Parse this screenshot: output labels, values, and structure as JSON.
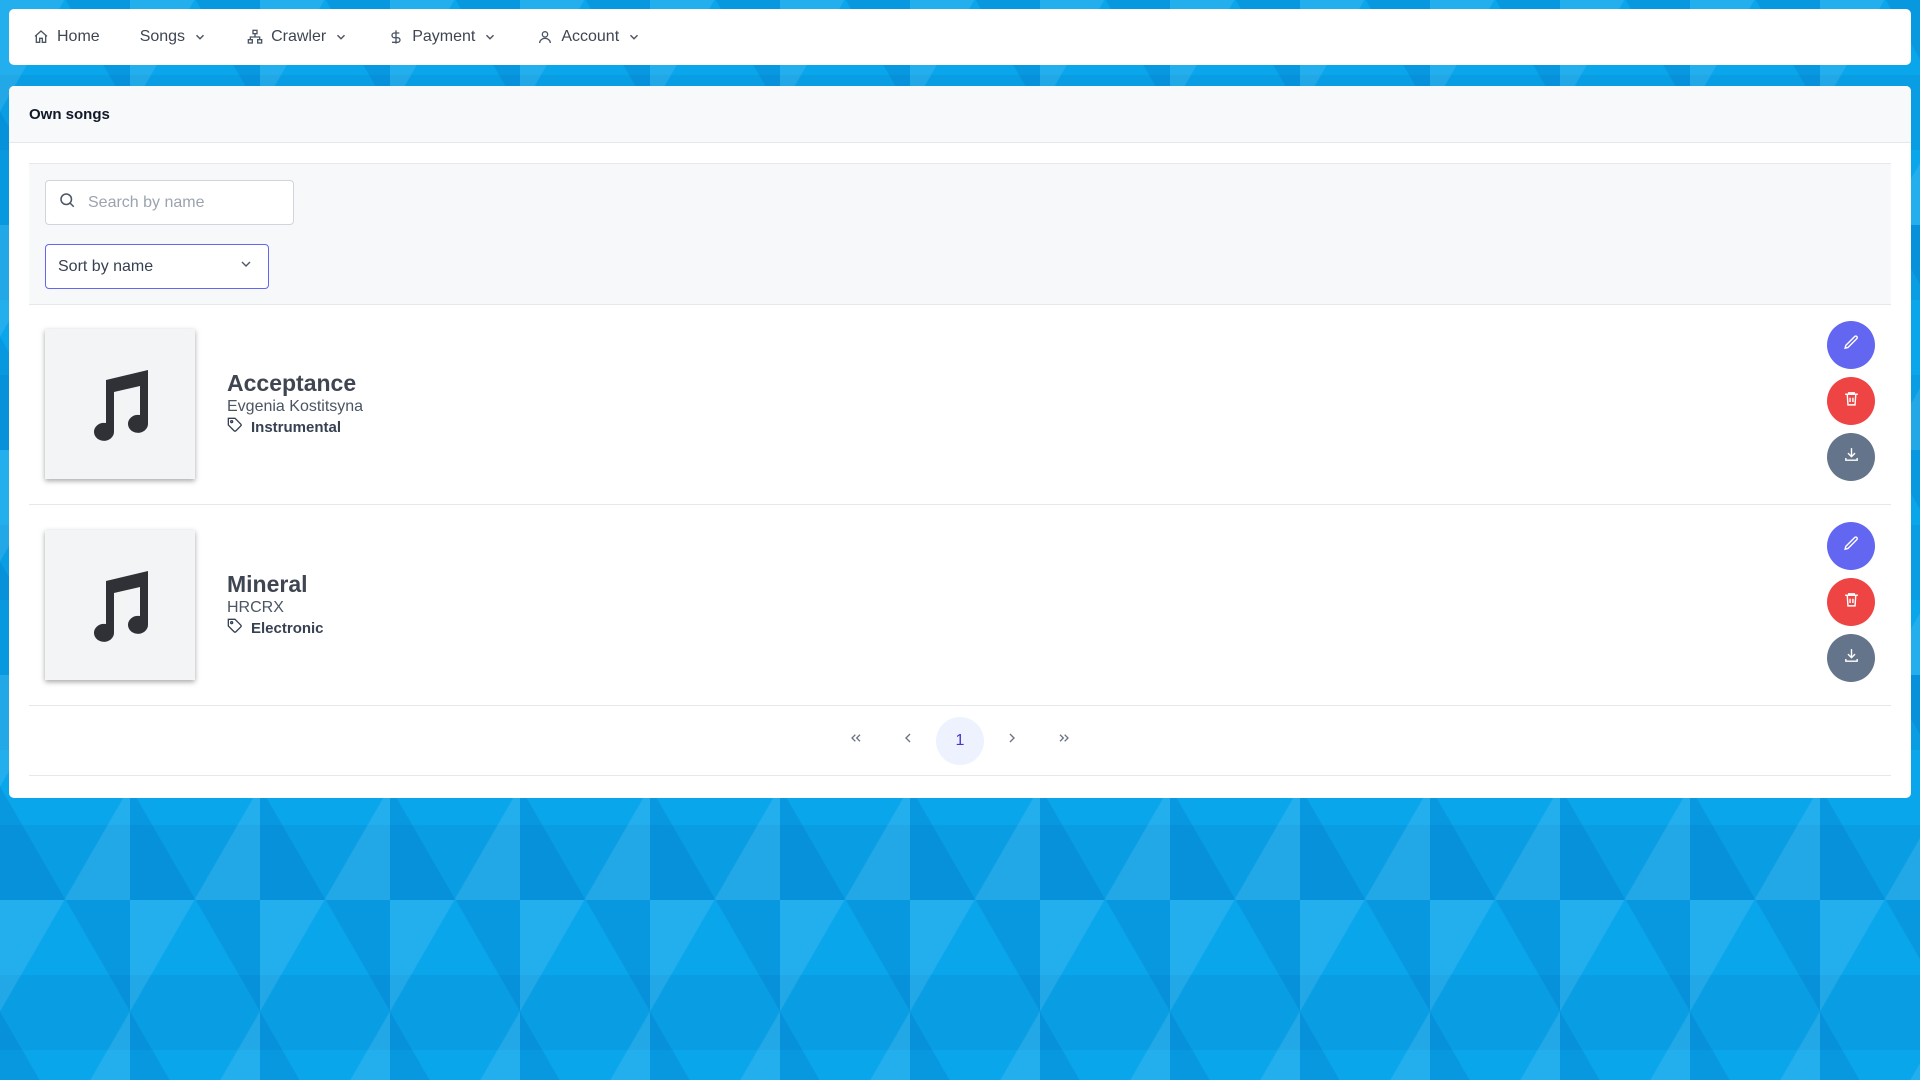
{
  "nav": {
    "items": [
      {
        "label": "Home",
        "icon": "home-icon"
      },
      {
        "label": "Songs",
        "icon": "chevron-down-icon"
      },
      {
        "label": "Crawler",
        "icon": "sitemap-icon"
      },
      {
        "label": "Payment",
        "icon": "dollar-icon"
      },
      {
        "label": "Account",
        "icon": "user-icon"
      }
    ]
  },
  "card": {
    "title": "Own songs"
  },
  "search": {
    "placeholder": "Search by name",
    "value": ""
  },
  "sort": {
    "selected": "Sort by name"
  },
  "songs": [
    {
      "title": "Acceptance",
      "artist": "Evgenia Kostitsyna",
      "genre": "Instrumental"
    },
    {
      "title": "Mineral",
      "artist": "HRCRX",
      "genre": "Electronic"
    }
  ],
  "pagination": {
    "current_page": "1"
  },
  "colors": {
    "edit": "#6366f1",
    "delete": "#ef4444",
    "download": "#64748b",
    "background": "#0aa6ec"
  }
}
